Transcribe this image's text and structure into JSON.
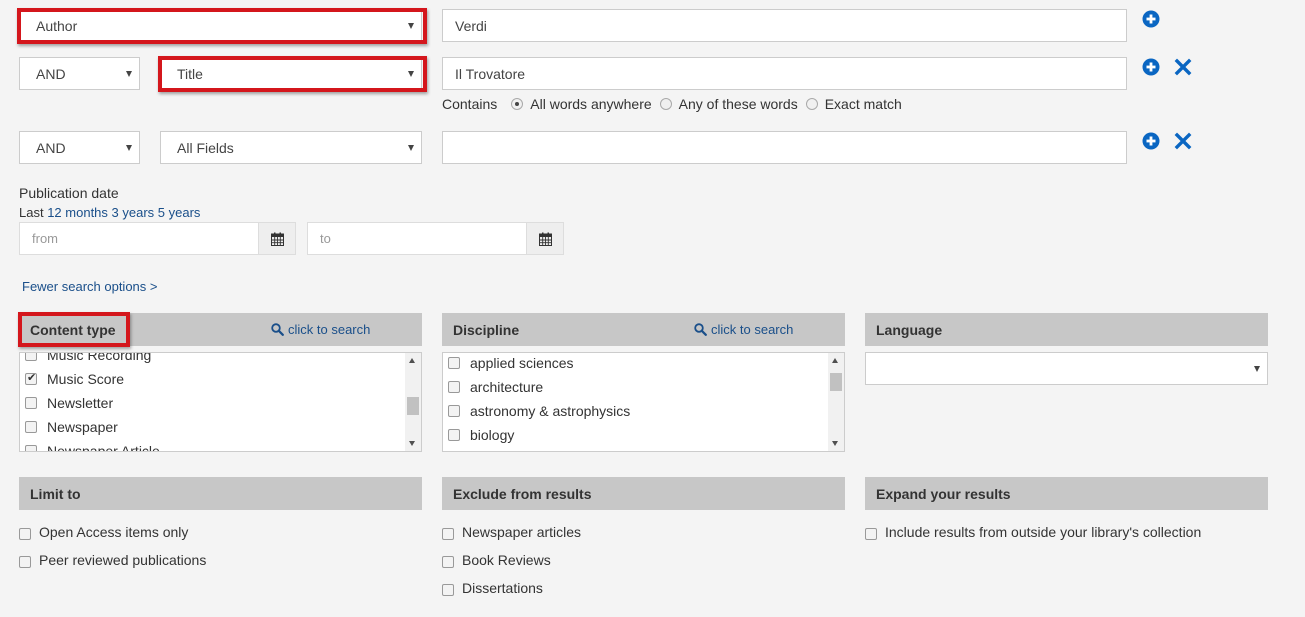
{
  "rows": [
    {
      "field": "Author",
      "value": "Verdi"
    },
    {
      "bool": "AND",
      "field": "Title",
      "value": "Il Trovatore"
    },
    {
      "bool": "AND",
      "field": "All Fields",
      "value": ""
    }
  ],
  "contains": {
    "label": "Contains",
    "options": [
      "All words anywhere",
      "Any of these words",
      "Exact match"
    ],
    "selected": "All words anywhere"
  },
  "pubdate": {
    "label": "Publication date",
    "last": "Last",
    "months": "12 months",
    "years3": "3 years",
    "years5": "5 years",
    "from_placeholder": "from",
    "to_placeholder": "to"
  },
  "fewer_options": "Fewer search options >",
  "content_type": {
    "title": "Content type",
    "search": "click to search",
    "items": [
      {
        "label": "Music Recording",
        "checked": false
      },
      {
        "label": "Music Score",
        "checked": true
      },
      {
        "label": "Newsletter",
        "checked": false
      },
      {
        "label": "Newspaper",
        "checked": false
      },
      {
        "label": "Newspaper Article",
        "checked": false
      }
    ]
  },
  "discipline": {
    "title": "Discipline",
    "search": "click to search",
    "items": [
      {
        "label": "applied sciences",
        "checked": false
      },
      {
        "label": "architecture",
        "checked": false
      },
      {
        "label": "astronomy & astrophysics",
        "checked": false
      },
      {
        "label": "biology",
        "checked": false
      }
    ]
  },
  "language": {
    "title": "Language",
    "value": ""
  },
  "limit_to": {
    "title": "Limit to",
    "items": [
      "Open Access items only",
      "Peer reviewed publications"
    ]
  },
  "exclude": {
    "title": "Exclude from results",
    "items": [
      "Newspaper articles",
      "Book Reviews",
      "Dissertations"
    ]
  },
  "expand": {
    "title": "Expand your results",
    "items": [
      "Include results from outside your library's collection"
    ]
  },
  "colors": {
    "accent": "#0a66c2",
    "link": "#1a4f8a",
    "highlight": "#d4161c"
  }
}
